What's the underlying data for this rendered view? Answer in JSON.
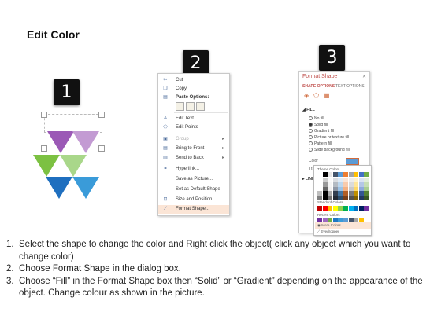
{
  "title": "Edit Color",
  "badges": [
    "1",
    "2",
    "3"
  ],
  "context_menu": {
    "items": [
      {
        "label": "Cut",
        "icon": "scissors-icon",
        "glyph": "✂"
      },
      {
        "label": "Copy",
        "icon": "copy-icon",
        "glyph": "❐"
      },
      {
        "label": "Paste Options:",
        "icon": "paste-icon",
        "glyph": "📋"
      },
      {
        "label": "Edit Text",
        "icon": "edit-text-icon",
        "glyph": "A"
      },
      {
        "label": "Edit Points",
        "icon": "edit-points-icon",
        "glyph": "⬠"
      },
      {
        "label": "Group",
        "icon": "group-icon",
        "glyph": "▣"
      },
      {
        "label": "Bring to Front",
        "icon": "bring-front-icon",
        "glyph": "▤"
      },
      {
        "label": "Send to Back",
        "icon": "send-back-icon",
        "glyph": "▥"
      },
      {
        "label": "Hyperlink...",
        "icon": "hyperlink-icon",
        "glyph": "⚭"
      },
      {
        "label": "Save as Picture...",
        "icon": "",
        "glyph": ""
      },
      {
        "label": "Set as Default Shape",
        "icon": "",
        "glyph": ""
      },
      {
        "label": "Size and Position...",
        "icon": "size-position-icon",
        "glyph": "⊡"
      },
      {
        "label": "Format Shape...",
        "icon": "format-shape-icon",
        "glyph": "⟋"
      }
    ]
  },
  "format_pane": {
    "title": "Format Shape",
    "close": "✕",
    "tabs": [
      "SHAPE OPTIONS",
      "TEXT OPTIONS"
    ],
    "fill_section": "FILL",
    "fill_options": [
      "No fill",
      "Solid fill",
      "Gradient fill",
      "Picture or texture fill",
      "Pattern fill",
      "Slide background fill"
    ],
    "selected_fill": "Solid fill",
    "color_label": "Color",
    "transparency_label": "Tra",
    "line_section": "LINE"
  },
  "color_picker": {
    "theme_label": "Theme Colors",
    "standard_label": "Standard Colors",
    "recent_label": "Recent Colors",
    "more_colors": "More Colors...",
    "eyedropper": "Eyedropper",
    "theme_colors": [
      "#ffffff",
      "#000000",
      "#e7e6e6",
      "#44546a",
      "#5b9bd5",
      "#ed7d31",
      "#a5a5a5",
      "#ffc000",
      "#4472c4",
      "#70ad47"
    ],
    "standard_colors": [
      "#c00000",
      "#ff0000",
      "#ffc000",
      "#ffff00",
      "#92d050",
      "#00b050",
      "#00b0f0",
      "#0070c0",
      "#002060",
      "#7030a0"
    ],
    "recent_colors": [
      "#7030a0",
      "#9e6ac0",
      "#70ad47",
      "#1f77c4",
      "#3a9bd9",
      "#5b9bd5",
      "#44546a",
      "#a5a5a5",
      "#ffc000"
    ]
  },
  "triangles": {
    "colors": [
      "#9b59b6",
      "#c39bd3",
      "#7cc142",
      "#a9d78a",
      "#1f6fbf",
      "#3a9bd9"
    ]
  },
  "steps": [
    {
      "num": "1.",
      "text": "Select the shape to change the color and Right click the object( click any object which you want to change color)"
    },
    {
      "num": "2.",
      "text": "Choose Format Shape in the dialog box."
    },
    {
      "num": "3.",
      "text": "Choose “Fill” in the Format Shape box then “Solid” or “Gradient” depending on the appearance of the object. Change colour as shown in the picture."
    }
  ]
}
